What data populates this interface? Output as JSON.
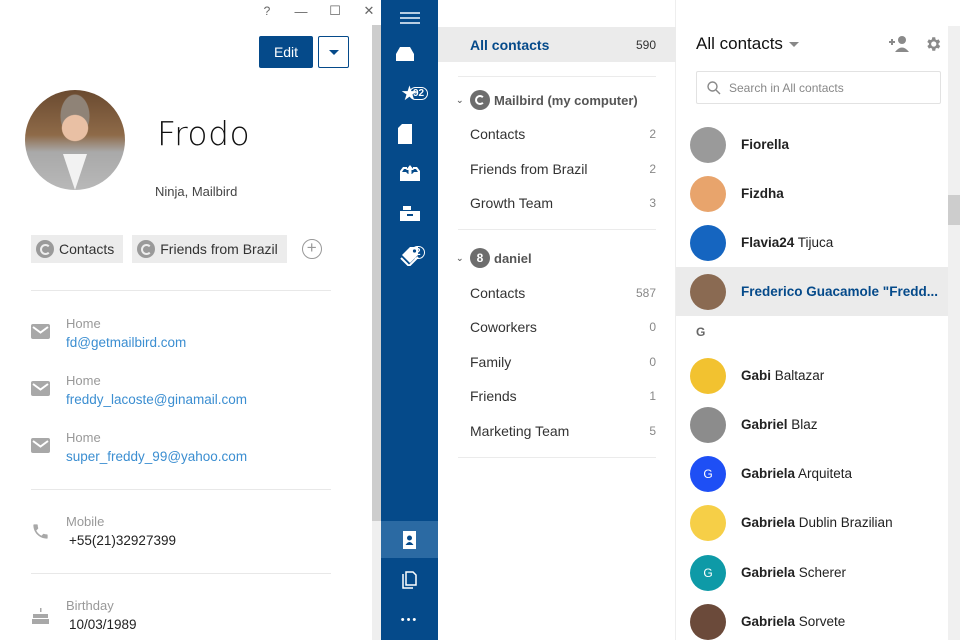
{
  "window": {
    "help_label": "?",
    "minimize_label": "—",
    "maximize_label": "☐",
    "close_label": "✕"
  },
  "detail": {
    "edit_label": "Edit",
    "name": "Frodo",
    "subtitle": "Ninja, Mailbird",
    "groups": [
      {
        "label": "Contacts"
      },
      {
        "label": "Friends from Brazil"
      }
    ],
    "add_group_label": "+",
    "emails": [
      {
        "label": "Home",
        "value": "fd@getmailbird.com"
      },
      {
        "label": "Home",
        "value": "freddy_lacoste@ginamail.com"
      },
      {
        "label": "Home",
        "value": "super_freddy_99@yahoo.com"
      }
    ],
    "phone": {
      "label": "Mobile",
      "value": "+55(21)32927399"
    },
    "birthday": {
      "label": "Birthday",
      "value": "10/03/1989"
    }
  },
  "nav": {
    "inbox_badge": "92",
    "drafts_badge": "2",
    "more_label": "•••"
  },
  "folders": {
    "all": {
      "label": "All contacts",
      "count": "590"
    },
    "accounts": [
      {
        "name": "Mailbird (my computer)",
        "icon": "mailbird-icon",
        "groups": [
          {
            "label": "Contacts",
            "count": "2"
          },
          {
            "label": "Friends from Brazil",
            "count": "2"
          },
          {
            "label": "Growth Team",
            "count": "3"
          }
        ]
      },
      {
        "name": "daniel",
        "icon": "google-icon",
        "icon_glyph": "8",
        "groups": [
          {
            "label": "Contacts",
            "count": "587"
          },
          {
            "label": "Coworkers",
            "count": "0"
          },
          {
            "label": "Family",
            "count": "0"
          },
          {
            "label": "Friends",
            "count": "1"
          },
          {
            "label": "Marketing Team",
            "count": "5"
          }
        ]
      }
    ]
  },
  "list": {
    "title": "All contacts",
    "search_placeholder": "Search in All contacts",
    "section_g": "G",
    "contacts": [
      {
        "first": "Fiorella",
        "last": "",
        "initial": "",
        "color": "#9a9a9a"
      },
      {
        "first": "Fizdha",
        "last": "",
        "initial": "",
        "color": "#e8a46c"
      },
      {
        "first": "Flavia24",
        "last": "Tijuca",
        "initial": "",
        "color": "#1565c0"
      },
      {
        "first": "Frederico Guacamole \"Fredd...",
        "last": "",
        "initial": "",
        "color": "#8a6a52",
        "selected": true
      },
      {
        "first": "Gabi",
        "last": "Baltazar",
        "initial": "",
        "color": "#f2c230"
      },
      {
        "first": "Gabriel",
        "last": "Blaz",
        "initial": "",
        "color": "#8c8c8c"
      },
      {
        "first": "Gabriela",
        "last": "Arquiteta",
        "initial": "G",
        "color": "#1e4ff5"
      },
      {
        "first": "Gabriela",
        "last": "Dublin Brazilian",
        "initial": "",
        "color": "#f6cf47"
      },
      {
        "first": "Gabriela",
        "last": "Scherer",
        "initial": "G",
        "color": "#0e9aa7"
      },
      {
        "first": "Gabriela",
        "last": "Sorvete",
        "initial": "",
        "color": "#6b4a3a"
      }
    ]
  },
  "colors": {
    "brand": "#054a8a",
    "link": "#3b8ed1"
  }
}
